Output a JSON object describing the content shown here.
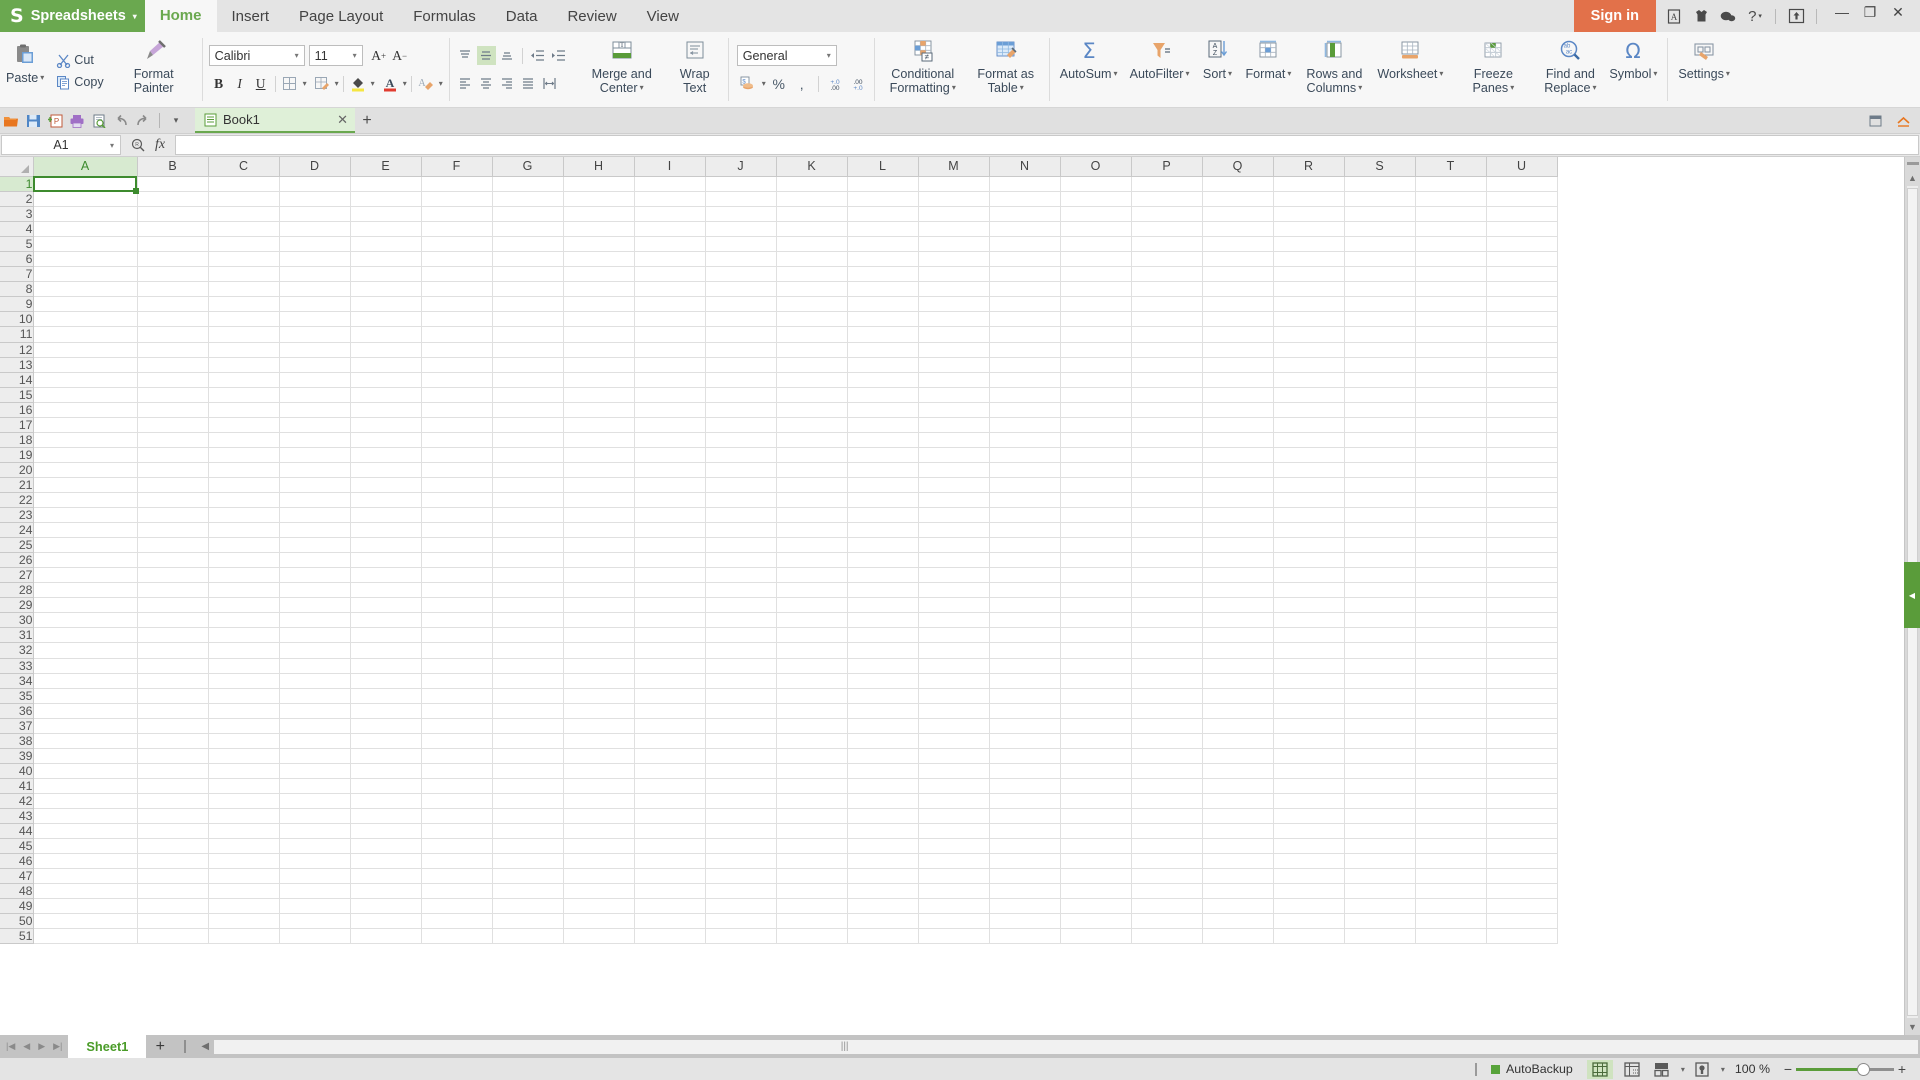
{
  "titlebar": {
    "brand": "Spreadsheets",
    "brand_caret": "▾",
    "menu_tabs": [
      {
        "label": "Home",
        "active": true
      },
      {
        "label": "Insert",
        "active": false
      },
      {
        "label": "Page Layout",
        "active": false
      },
      {
        "label": "Formulas",
        "active": false
      },
      {
        "label": "Data",
        "active": false
      },
      {
        "label": "Review",
        "active": false
      },
      {
        "label": "View",
        "active": false
      }
    ],
    "signin": "Sign in",
    "right_icons": [
      "document-icon",
      "shirt-icon",
      "feedback-icon",
      "help-icon"
    ],
    "help_caret": "▾",
    "share_icon": "share-upload-icon",
    "window_minimize": "—",
    "window_restore": "❐",
    "window_close": "✕"
  },
  "ribbon": {
    "clipboard": {
      "paste": "Paste",
      "paste_caret": "▾",
      "cut": "Cut",
      "copy": "Copy",
      "format_painter": "Format Painter"
    },
    "font": {
      "family_value": "Calibri",
      "size_value": "11",
      "grow_font": "A",
      "shrink_font": "A",
      "bold": "B",
      "italic": "I",
      "underline": "U",
      "borders_caret": "▾",
      "draw_border_caret": "▾",
      "fill_color_caret": "▾",
      "font_color_caret": "▾",
      "clear_format_caret": "▾"
    },
    "alignment": {
      "merge_and_center": "Merge and Center",
      "merge_caret": "▾",
      "wrap_text": "Wrap Text"
    },
    "number": {
      "format_value": "General",
      "percent": "%",
      "comma": "‚",
      "increase_decimal": ".00",
      "decrease_decimal": ".00"
    },
    "styles": [
      {
        "label": "Conditional Formatting",
        "caret": "▾",
        "icon": "conditional-formatting-icon"
      },
      {
        "label": "Format as Table",
        "caret": "▾",
        "icon": "format-as-table-icon"
      }
    ],
    "editing": [
      {
        "label": "AutoSum",
        "caret": "▾",
        "icon": "sigma-icon"
      },
      {
        "label": "AutoFilter",
        "caret": "▾",
        "icon": "funnel-icon"
      },
      {
        "label": "Sort",
        "caret": "▾",
        "icon": "sort-az-icon"
      },
      {
        "label": "Format",
        "caret": "▾",
        "icon": "format-cells-icon"
      },
      {
        "label": "Rows and Columns",
        "caret": "▾",
        "icon": "rows-columns-icon"
      },
      {
        "label": "Worksheet",
        "caret": "▾",
        "icon": "worksheet-icon"
      },
      {
        "label": "Freeze Panes",
        "caret": "▾",
        "icon": "freeze-panes-icon"
      },
      {
        "label": "Find and Replace",
        "caret": "▾",
        "icon": "find-replace-icon"
      },
      {
        "label": "Symbol",
        "caret": "▾",
        "icon": "omega-icon"
      }
    ],
    "settings": {
      "label": "Settings",
      "caret": "▾",
      "icon": "settings-icon"
    }
  },
  "quickaccess": {
    "icons": [
      "open-folder-icon",
      "save-icon",
      "save-as-icon",
      "print-icon",
      "print-preview-icon",
      "undo-icon",
      "redo-icon"
    ],
    "customize_caret": "▾",
    "document_tab": {
      "name": "Book1",
      "close": "✕",
      "icon": "workbook-icon"
    },
    "new_tab": "+",
    "right_icons": [
      "restore-down-icon",
      "expand-ribbon-icon"
    ]
  },
  "formulabar": {
    "namebox_value": "A1",
    "namebox_caret": "▾",
    "search_icon": "magnifier-icon",
    "fx_label": "fx",
    "formula_value": ""
  },
  "grid": {
    "columns": [
      "A",
      "B",
      "C",
      "D",
      "E",
      "F",
      "G",
      "H",
      "I",
      "J",
      "K",
      "L",
      "M",
      "N",
      "O",
      "P",
      "Q",
      "R",
      "S",
      "T",
      "U"
    ],
    "rows": [
      1,
      2,
      3,
      4,
      5,
      6,
      7,
      8,
      9,
      10,
      11,
      12,
      13,
      14,
      15,
      16,
      17,
      18,
      19,
      20,
      21,
      22,
      23,
      24,
      25,
      26,
      27,
      28,
      29,
      30,
      31,
      32,
      33,
      34,
      35,
      36,
      37,
      38,
      39,
      40,
      41,
      42,
      43,
      44,
      45,
      46,
      47,
      48,
      49,
      50,
      51
    ],
    "selected_cell": "A1",
    "selected_column": "A",
    "selected_row": 1
  },
  "sheetbar": {
    "nav_first": "|◀",
    "nav_prev": "◀",
    "nav_next": "▶",
    "nav_last": "▶|",
    "sheets": [
      {
        "name": "Sheet1",
        "active": true
      }
    ],
    "add_sheet": "+"
  },
  "statusbar": {
    "autobackup": "AutoBackup",
    "view_normal": "normal-view-icon",
    "view_pagebreak": "page-break-view-icon",
    "layout_icon": "page-layout-icon",
    "layout_caret": "▾",
    "reading_icon": "reading-mode-icon",
    "reading_caret": "▾",
    "zoom_label": "100 %",
    "zoom_out": "−",
    "zoom_in": "+"
  },
  "colors": {
    "brand_green": "#6aa84f",
    "signin_orange": "#e2714a",
    "selection_green": "#3d8b2e",
    "ribbon_bg": "#f7f7f7",
    "titlebar_bg": "#e4e4e4"
  }
}
